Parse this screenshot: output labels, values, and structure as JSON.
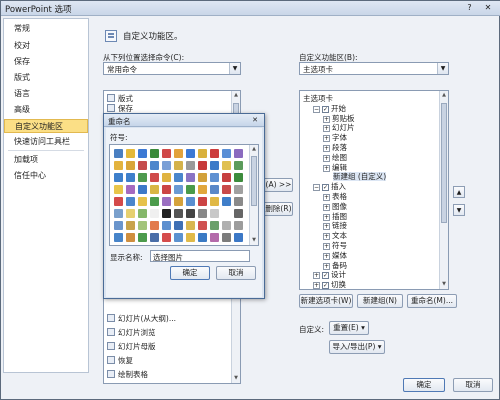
{
  "window": {
    "title": "PowerPoint 选项",
    "help_icon": "question-icon",
    "close_label": "✕"
  },
  "nav": {
    "items": [
      {
        "label": "常规",
        "selected": false
      },
      {
        "label": "校对",
        "selected": false
      },
      {
        "label": "保存",
        "selected": false
      },
      {
        "label": "版式",
        "selected": false
      },
      {
        "label": "语言",
        "selected": false
      },
      {
        "label": "高级",
        "selected": false
      },
      {
        "label": "自定义功能区",
        "selected": true
      },
      {
        "label": "快速访问工具栏",
        "selected": false
      },
      {
        "label": "加载项",
        "selected": false
      },
      {
        "label": "信任中心",
        "selected": false
      }
    ]
  },
  "header": {
    "text": "自定义功能区。"
  },
  "left": {
    "choose_label": "从下列位置选择命令(C):",
    "choose_value": "常用命令",
    "commands_top": [
      "版式",
      "保存"
    ],
    "commands_bottom": [
      "幻灯片(从大纲)...",
      "幻灯片浏览",
      "幻灯片母版",
      "恢复",
      "绘制表格"
    ]
  },
  "middle": {
    "add_label": "添加(A) >>",
    "remove_label": "<< 删除(R)"
  },
  "right": {
    "customize_label": "自定义功能区(B):",
    "customize_value": "主选项卡",
    "tree": [
      {
        "label": "主选项卡",
        "level": 0,
        "expander": "",
        "checkbox": ""
      },
      {
        "label": "开始",
        "level": 1,
        "expander": "−",
        "checkbox": "✓"
      },
      {
        "label": "剪贴板",
        "level": 2,
        "expander": "+",
        "checkbox": ""
      },
      {
        "label": "幻灯片",
        "level": 2,
        "expander": "+",
        "checkbox": ""
      },
      {
        "label": "字体",
        "level": 2,
        "expander": "+",
        "checkbox": ""
      },
      {
        "label": "段落",
        "level": 2,
        "expander": "+",
        "checkbox": ""
      },
      {
        "label": "绘图",
        "level": 2,
        "expander": "+",
        "checkbox": ""
      },
      {
        "label": "编辑",
        "level": 2,
        "expander": "+",
        "checkbox": ""
      },
      {
        "label": "新建组 (自定义)",
        "level": 3,
        "expander": "",
        "checkbox": "",
        "selected": true
      },
      {
        "label": "插入",
        "level": 1,
        "expander": "−",
        "checkbox": "✓"
      },
      {
        "label": "表格",
        "level": 2,
        "expander": "+",
        "checkbox": ""
      },
      {
        "label": "图像",
        "level": 2,
        "expander": "+",
        "checkbox": ""
      },
      {
        "label": "插图",
        "level": 2,
        "expander": "+",
        "checkbox": ""
      },
      {
        "label": "链接",
        "level": 2,
        "expander": "+",
        "checkbox": ""
      },
      {
        "label": "文本",
        "level": 2,
        "expander": "+",
        "checkbox": ""
      },
      {
        "label": "符号",
        "level": 2,
        "expander": "+",
        "checkbox": ""
      },
      {
        "label": "媒体",
        "level": 2,
        "expander": "+",
        "checkbox": ""
      },
      {
        "label": "备码",
        "level": 2,
        "expander": "+",
        "checkbox": ""
      },
      {
        "label": "设计",
        "level": 1,
        "expander": "+",
        "checkbox": "✓"
      },
      {
        "label": "切换",
        "level": 1,
        "expander": "+",
        "checkbox": "✓"
      }
    ],
    "new_tab_label": "新建选项卡(W)",
    "new_group_label": "新建组(N)",
    "rename_label": "重命名(M)...",
    "custom_label": "自定义:",
    "reset_label": "重置(E) ▾",
    "import_export_label": "导入/导出(P) ▾"
  },
  "dialog": {
    "title": "重命名",
    "symbol_label": "符号:",
    "display_name_label": "显示名称:",
    "display_name_value": "选择图片",
    "ok_label": "确定",
    "cancel_label": "取消",
    "icon_colors": [
      "#4a7fc1",
      "#e4b93a",
      "#3c79d4",
      "#3a8a3a",
      "#d04848",
      "#e2a23b",
      "#3c79d4",
      "#d9b13d",
      "#cc3c3c",
      "#5a8fd6",
      "#8b6bbf",
      "#e3b33e",
      "#d9a537",
      "#c54b4b",
      "#4d86cc",
      "#7a9fd6",
      "#d4b24a",
      "#9a9a9a",
      "#c73a3a",
      "#3c7ac8",
      "#e0c050",
      "#5b9b5b",
      "#3e7fcb",
      "#3e7fcb",
      "#4e9a4e",
      "#cf4a4a",
      "#e0b340",
      "#4a86cc",
      "#8a74c4",
      "#d2a13a",
      "#5f91d2",
      "#c74040",
      "#3d8c3d",
      "#e8c54a",
      "#a56ac0",
      "#3c79c8",
      "#d8b645",
      "#cc4545",
      "#6a9ad4",
      "#4a9a4a",
      "#e1a73c",
      "#5a88c8",
      "#c94a4a",
      "#a0a0a0",
      "#d44a4a",
      "#4b86cc",
      "#e6c24b",
      "#4c9c4c",
      "#9b6fc2",
      "#d5a23c",
      "#5a8fd0",
      "#cb4444",
      "#e0b845",
      "#3f7ec9",
      "#8a8a8a",
      "#7aa0cc",
      "#e6d070",
      "#86b86a",
      "#f0f0f0",
      "#222222",
      "#555555",
      "#444444",
      "#888888",
      "#c8c8c8",
      "#ffffff",
      "#666666",
      "#6a95cc",
      "#c8a34a",
      "#a3c47a",
      "#e27a4c",
      "#5c8fcf",
      "#3e6fb4",
      "#d8b650",
      "#cf5050",
      "#6aa06a",
      "#b0b0b0",
      "#9c9c9c",
      "#4784c9",
      "#cf8e3e",
      "#4c9b4c",
      "#4a6ea8",
      "#d54c4c",
      "#5c92d0",
      "#e0ba48",
      "#3a7ac4",
      "#b46aaa",
      "#7c7c7c",
      "#3c78c6"
    ]
  }
}
